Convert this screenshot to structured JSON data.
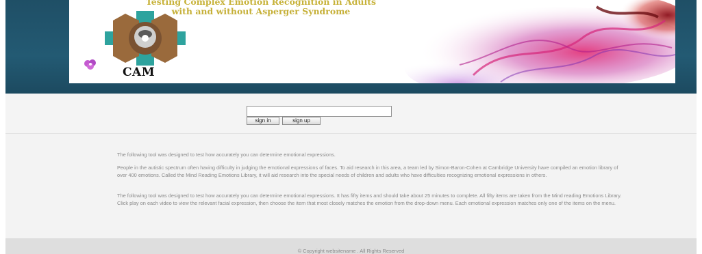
{
  "banner": {
    "title_line1": "Testing Complex Emotion Recognition in Adults",
    "title_line2": "with and without Asperger Syndrome",
    "logo_text": "CAM"
  },
  "login": {
    "input_value": "",
    "sign_in_label": "sign in",
    "sign_up_label": "sign up"
  },
  "content": {
    "paragraph1": "The following tool was designed to test how accurately you can determine emotional expressions.",
    "paragraph2": "People in the autistic spectrum often having difficulty in judging the emotional expressions of faces. To aid research in this area, a team led by Simon-Baron-Cohen at Cambridge University have compiled an emotion library of over 400 emotions. Called the Mind Reading Emotions Library, it will aid research into the special needs of children and adults who have difficulties recognizing emotional expressions in others.",
    "paragraph3": "The following tool was designed to test how accurately you can determine emotional expressions. It has fifty items and should take about 25 minutes to complete. All fifty items are taken from the Mind reading Emotions Library. Click play on each video to view the relevant facial expression, then choose the item that most closely matches the emotion from the drop-down menu. Each emotional expression matches only one of the items on the menu."
  },
  "footer": {
    "copyright": "© Copyright websitename . All Rights Reserved"
  },
  "colors": {
    "header_band": "#1f4f66",
    "banner_title": "#c9b23a",
    "body_text": "#8a8a8a",
    "content_bg": "#f3f3f3",
    "footer_bg": "#dedede"
  }
}
